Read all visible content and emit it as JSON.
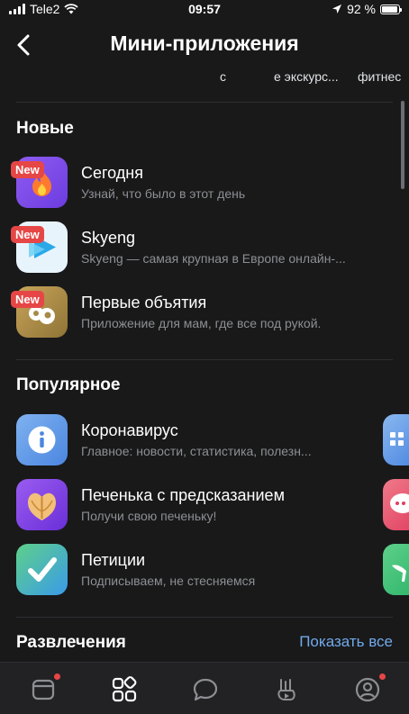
{
  "status_bar": {
    "carrier": "Tele2",
    "time": "09:57",
    "battery_text": "92 %",
    "battery_level": 0.92
  },
  "nav": {
    "title": "Мини-приложения"
  },
  "tabs": [
    "с",
    "е экскурс...",
    "фитнес"
  ],
  "sections": {
    "new": {
      "title": "Новые",
      "apps": [
        {
          "name": "Сегодня",
          "desc": "Узнай, что было в этот день",
          "badge": "New"
        },
        {
          "name": "Skyeng",
          "desc": "Skyeng — самая крупная в Европе онлайн-...",
          "badge": "New"
        },
        {
          "name": "Первые объятия",
          "desc": "Приложение для мам, где все под рукой.",
          "badge": "New"
        }
      ]
    },
    "popular": {
      "title": "Популярное",
      "apps": [
        {
          "name": "Коронавирус",
          "desc": "Главное: новости, статистика, полезн..."
        },
        {
          "name": "Печенька с предсказанием",
          "desc": "Получи свою печеньку!"
        },
        {
          "name": "Петиции",
          "desc": "Подписываем, не стесняемся"
        }
      ]
    },
    "entertainment": {
      "title": "Развлечения",
      "show_all": "Показать все"
    }
  },
  "colors": {
    "background": "#19191a",
    "accent": "#71aaeb",
    "badge": "#e64646"
  }
}
